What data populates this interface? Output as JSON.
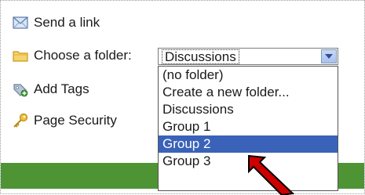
{
  "options": {
    "send_link": "Send a link",
    "choose_folder_label": "Choose a folder:",
    "add_tags": "Add Tags",
    "page_security": "Page Security"
  },
  "folder_select": {
    "selected_value": "Discussions",
    "list": [
      "(no folder)",
      "Create a new folder...",
      "Discussions",
      "Group 1",
      "Group 2",
      "Group 3"
    ],
    "highlighted_index": 4
  },
  "colors": {
    "green_bar": "#4e9435",
    "highlight": "#3a62b8",
    "arrow": "#cc0000"
  },
  "icons": {
    "send_link": "envelope-icon",
    "choose_folder": "folder-icon",
    "add_tags": "tag-icon",
    "page_security": "key-icon"
  }
}
